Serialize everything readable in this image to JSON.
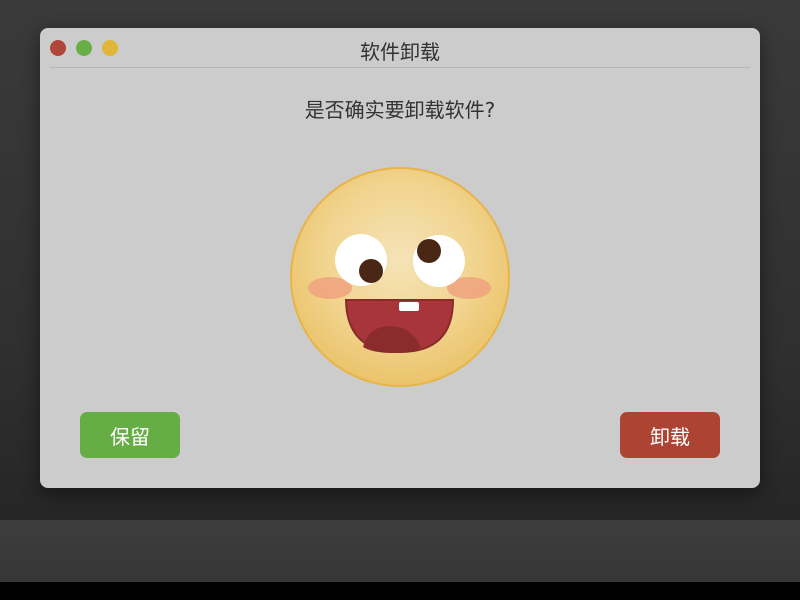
{
  "window": {
    "title": "软件卸载",
    "controls": [
      {
        "name": "close",
        "color": "#b0463a"
      },
      {
        "name": "minimize",
        "color": "#6aae48"
      },
      {
        "name": "maximize",
        "color": "#e0b638"
      }
    ]
  },
  "dialog": {
    "question": "是否确实要卸载软件?",
    "emoji": "smiley-face-icon",
    "keep_label": "保留",
    "uninstall_label": "卸载"
  },
  "colors": {
    "desktop": "#333333",
    "window_bg": "#cccccc",
    "keep_button": "#67ad46",
    "uninstall_button": "#ad4332",
    "face_fill": "#f1d48f",
    "face_outline": "#e8b448",
    "mouth": "#a8353a",
    "cheeks": "#f0a27e"
  }
}
